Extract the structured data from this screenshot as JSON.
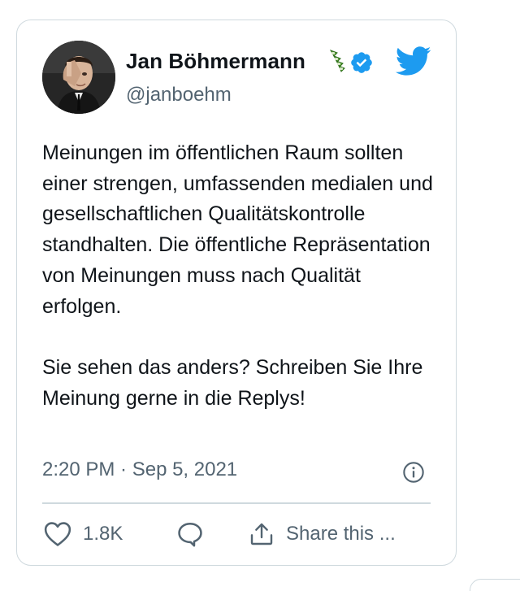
{
  "tweet": {
    "author": {
      "name": "Jan Böhmermann",
      "handle": "@janboehm",
      "avatar_icon": "avatar-photo",
      "name_emoji_icon": "vertebrae-emoji-icon",
      "verified": true
    },
    "text": "Meinungen im öffentlichen Raum sollten einer strengen, umfassenden medialen und gesellschaftlichen Qualitätskontrolle standhalten. Die öffentliche Repräsentation von Meinungen muss nach Qualität erfolgen.\n\nSie sehen das anders? Schreiben Sie Ihre Meinung gerne in die Replys!",
    "timestamp": "2:20 PM · Sep 5, 2021",
    "actions": {
      "like_count": "1.8K",
      "share_label": "Share this ..."
    }
  },
  "icons": {
    "brand": "twitter-bird-icon",
    "info": "info-icon",
    "like": "heart-icon",
    "reply": "comment-bubble-icon",
    "share": "share-upload-icon"
  },
  "colors": {
    "twitter_blue": "#1d9bf0",
    "text_primary": "#0f1419",
    "text_secondary": "#536471",
    "border": "#cfd9de",
    "emoji_green": "#5fa83a"
  }
}
